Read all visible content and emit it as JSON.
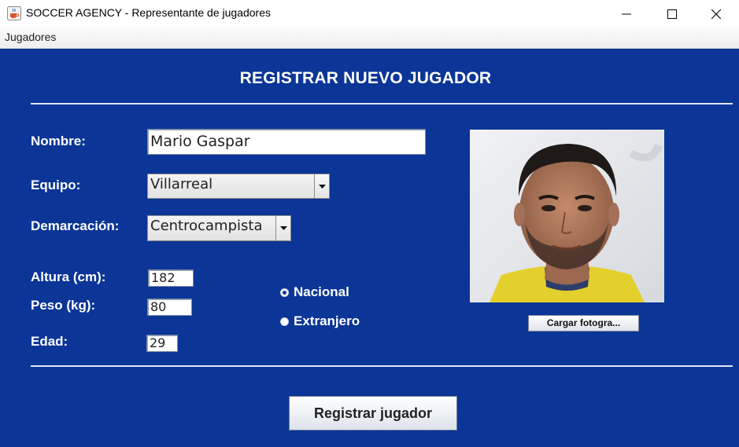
{
  "window": {
    "title": "SOCCER AGENCY - Representante de jugadores",
    "icon": "java-cup-icon"
  },
  "menubar": {
    "items": [
      {
        "label": "Jugadores"
      }
    ]
  },
  "form": {
    "title": "REGISTRAR NUEVO JUGADOR",
    "nombre": {
      "label": "Nombre:",
      "value": "Mario Gaspar"
    },
    "equipo": {
      "label": "Equipo:",
      "selected": "Villarreal"
    },
    "demarcacion": {
      "label": "Demarcación:",
      "selected": "Centrocampista"
    },
    "altura": {
      "label": "Altura (cm):",
      "value": "182"
    },
    "peso": {
      "label": "Peso (kg):",
      "value": "80"
    },
    "edad": {
      "label": "Edad:",
      "value": "29"
    },
    "nacionalidad": {
      "options": [
        {
          "label": "Nacional",
          "selected": true
        },
        {
          "label": "Extranjero",
          "selected": false
        }
      ]
    },
    "photo_button": "Cargar fotogra...",
    "submit_button": "Registrar jugador"
  },
  "colors": {
    "panel_background": "#0b3596",
    "label_text": "#ffffff"
  }
}
